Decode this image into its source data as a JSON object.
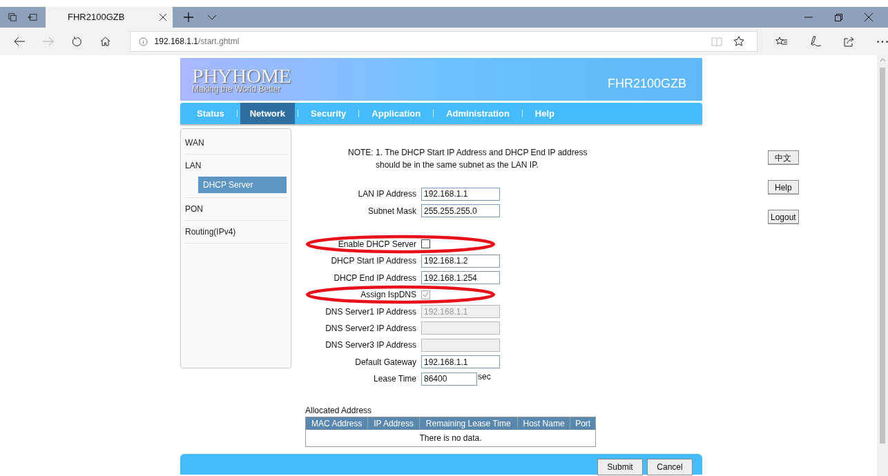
{
  "browser": {
    "tab_title": "FHR2100GZB",
    "url_host": "192.168.1.1",
    "url_path": "/start.ghtml"
  },
  "header": {
    "logo": "PHYHOME",
    "slogan": "Making the World Better",
    "model": "FHR2100GZB"
  },
  "nav": [
    {
      "label": "Status",
      "selected": false
    },
    {
      "label": "Network",
      "selected": true
    },
    {
      "label": "Security",
      "selected": false
    },
    {
      "label": "Application",
      "selected": false
    },
    {
      "label": "Administration",
      "selected": false
    },
    {
      "label": "Help",
      "selected": false
    }
  ],
  "sidebar": [
    {
      "label": "WAN"
    },
    {
      "label": "LAN",
      "children": [
        {
          "label": "DHCP Server",
          "selected": true
        }
      ]
    },
    {
      "label": "PON"
    },
    {
      "label": "Routing(IPv4)"
    }
  ],
  "note": [
    "NOTE: 1. The DHCP Start IP Address and DHCP End IP address",
    "should be in the same subnet as the LAN IP."
  ],
  "side_buttons": [
    "中文",
    "Help",
    "Logout"
  ],
  "form": [
    {
      "kind": "text",
      "label": "LAN IP Address",
      "value": "192.168.1.1",
      "disabled": false
    },
    {
      "kind": "text",
      "label": "Subnet Mask",
      "value": "255.255.255.0",
      "disabled": false
    },
    {
      "kind": "gap"
    },
    {
      "kind": "checkbox",
      "label": "Enable DHCP Server",
      "checked": false,
      "disabled": false,
      "circled": true
    },
    {
      "kind": "text",
      "label": "DHCP Start IP Address",
      "value": "192.168.1.2",
      "disabled": false
    },
    {
      "kind": "text",
      "label": "DHCP End IP Address",
      "value": "192.168.1.254",
      "disabled": false
    },
    {
      "kind": "checkbox",
      "label": "Assign IspDNS",
      "checked": true,
      "disabled": true,
      "circled": true
    },
    {
      "kind": "text",
      "label": "DNS Server1 IP Address",
      "value": "192.168.1.1",
      "disabled": true
    },
    {
      "kind": "text",
      "label": "DNS Server2 IP Address",
      "disabled": true
    },
    {
      "kind": "text",
      "label": "DNS Server3 IP Address",
      "disabled": true
    },
    {
      "kind": "text",
      "label": "Default Gateway",
      "value": "192.168.1.1",
      "disabled": false
    },
    {
      "kind": "unit",
      "label": "Lease Time",
      "value": "86400",
      "unit": "sec",
      "disabled": false
    }
  ],
  "table": {
    "title": "Allocated Address",
    "columns": [
      "MAC Address",
      "IP Address",
      "Remaining Lease Time",
      "Host Name",
      "Port"
    ],
    "empty_text": "There is no data."
  },
  "footer_buttons": [
    "Submit",
    "Cancel"
  ]
}
